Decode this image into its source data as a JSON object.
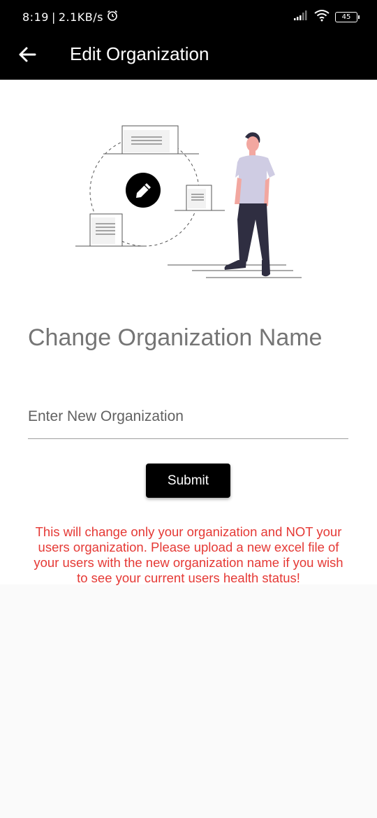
{
  "status_bar": {
    "time": "8:19",
    "network_speed": "2.1KB/s",
    "battery_level": "45",
    "icons": [
      "alarm-icon",
      "signal-icon",
      "wifi-icon",
      "battery-icon"
    ]
  },
  "app_bar": {
    "title": "Edit Organization",
    "back_icon": "arrow-left-icon"
  },
  "main": {
    "heading": "Change Organization Name",
    "input_placeholder": "Enter New Organization",
    "input_value": "",
    "submit_label": "Submit",
    "warning_text": "This will change only your organization and NOT your users organization. Please upload a new excel file of your users with the new organization name if you wish to see your current users health status!"
  },
  "colors": {
    "app_bar_bg": "#000000",
    "heading": "#757575",
    "warning": "#e53935",
    "button_bg": "#000000",
    "illustration_shirt": "#cfcce3",
    "illustration_pants": "#2f2e41"
  }
}
